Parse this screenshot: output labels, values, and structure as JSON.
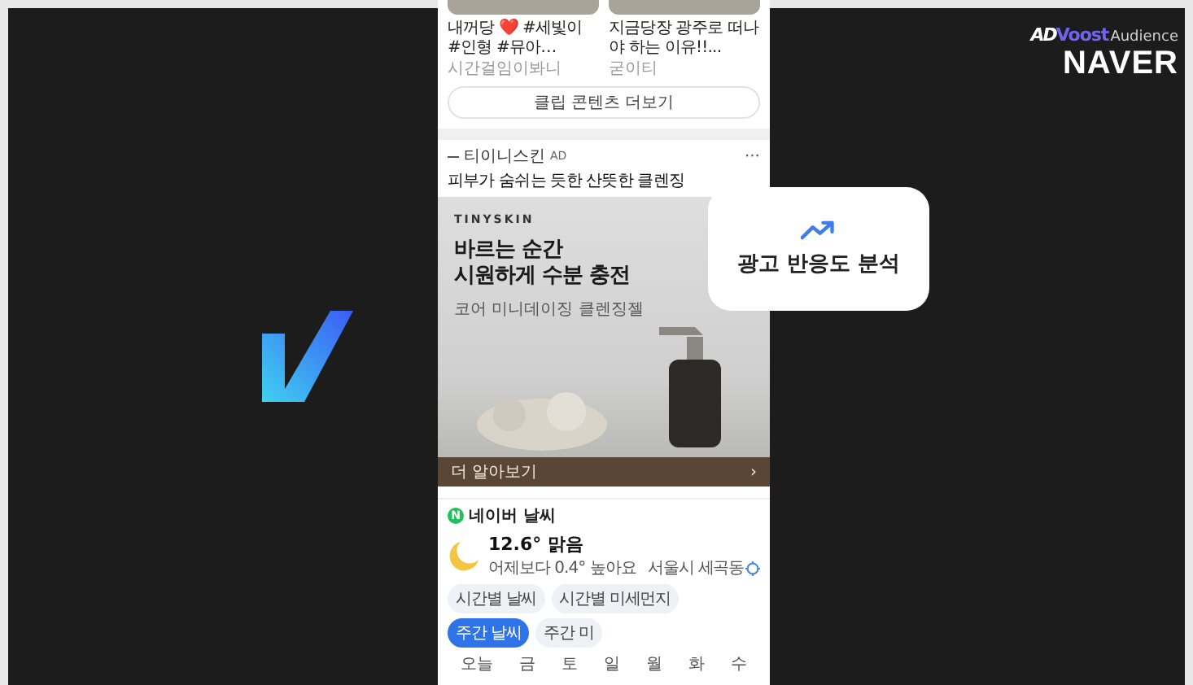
{
  "clip_cards": [
    {
      "title": "내꺼당 ❤️ #세빛이 #인형 #뮤아…",
      "source": "시간걸임이봐니"
    },
    {
      "title": "지금당장 광주로 떠나야 하는 이유!!...",
      "source": "굳이티"
    }
  ],
  "more_button": "클립 콘텐츠 더보기",
  "ad": {
    "advertiser": "티이니스킨",
    "badge": "AD",
    "menu": "···",
    "description": "피부가 숨쉬는 듯한 산뜻한 클렌징",
    "brand": "TINYSKIN",
    "headline": [
      "바르는 순간",
      "시원하게 수분 충전"
    ],
    "subline": "코어 미니데이징 클렌징젤",
    "cta": "더 알아보기",
    "cta_arrow": "›"
  },
  "weather": {
    "provider_badge": "N",
    "provider": "네이버 날씨",
    "temperature": "12.6° 맑음",
    "comparison": "어제보다 0.4° 높아요",
    "location": "서울시 세곡동",
    "chips": [
      {
        "label": "시간별 날씨",
        "selected": false
      },
      {
        "label": "시간별 미세먼지",
        "selected": false
      },
      {
        "label": "주간 날씨",
        "selected": true
      },
      {
        "label": "주간 미",
        "selected": false
      }
    ],
    "days": [
      "오늘",
      "금",
      "토",
      "일",
      "월",
      "화",
      "수"
    ]
  },
  "callout": {
    "label": "광고 반응도 분석"
  },
  "branding": {
    "product_prefix": "AD",
    "product_name": "Voost",
    "product_suffix": "Audience",
    "company": "NAVER"
  }
}
